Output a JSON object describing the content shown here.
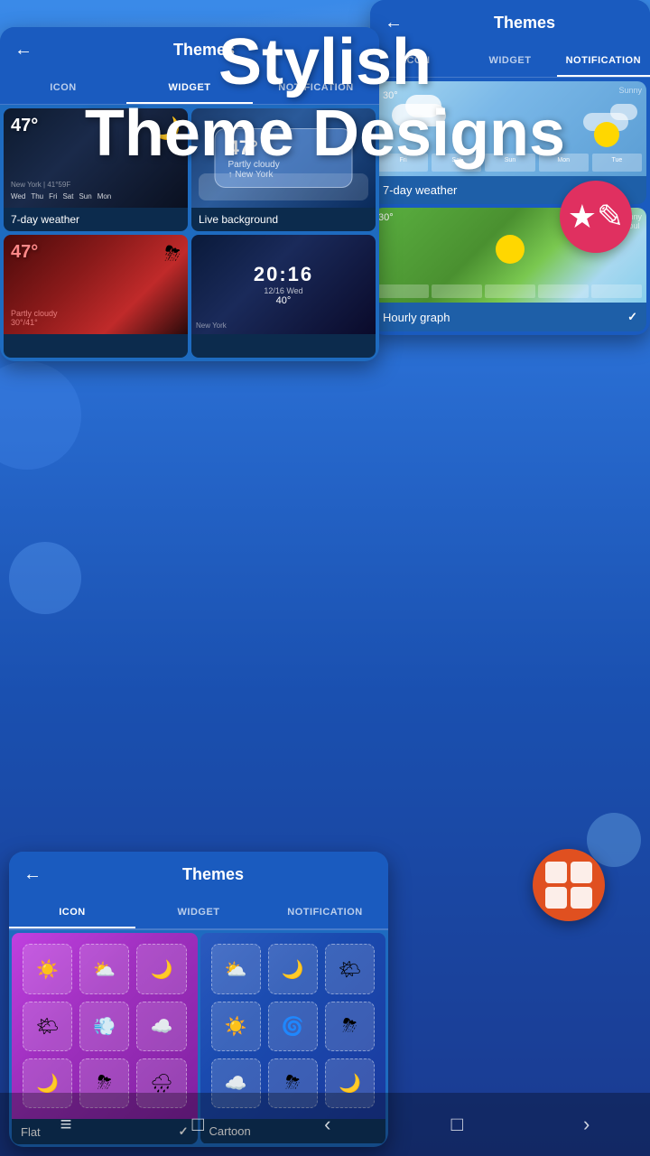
{
  "hero": {
    "title_line1": "Stylish",
    "title_line2": "Theme Designs"
  },
  "badge_button": {
    "icon": "★✎"
  },
  "panel_right": {
    "header_title": "Themes",
    "tabs": [
      "ICON",
      "WIDGET",
      "NOTIFICATION"
    ],
    "active_tab": "NOTIFICATION",
    "cards": [
      {
        "label": "7-day weather",
        "checked": false
      },
      {
        "label": "Hourly graph",
        "checked": true
      }
    ]
  },
  "panel_mid": {
    "header_title": "Themes",
    "tabs": [
      "ICON",
      "WIDGET",
      "NOTIFICATION"
    ],
    "active_tab": "WIDGET",
    "theme_cards": [
      {
        "temp": "47°",
        "label": "7-day weather",
        "type": "dark"
      },
      {
        "temp": "47°",
        "label": "Live background",
        "type": "glass"
      },
      {
        "temp": "47°",
        "label": "",
        "type": "red"
      },
      {
        "temp": "40°",
        "label": "",
        "type": "blue"
      }
    ]
  },
  "panel_bottom": {
    "header_title": "Themes",
    "tabs": [
      "ICON",
      "WIDGET",
      "NOTIFICATION"
    ],
    "active_tab": "ICON",
    "icon_themes": [
      {
        "name": "Flat",
        "checked": true,
        "type": "flat",
        "icons": [
          "☀️",
          "⛅",
          "🌙",
          "🌤",
          "💨",
          "☁️",
          "🌙",
          "⛈",
          "🌧"
        ]
      },
      {
        "name": "Cartoon",
        "checked": false,
        "type": "cartoon",
        "icons": [
          "⛅",
          "🌙",
          "🌤",
          "☀️",
          "🌀",
          "⛈",
          "☁️",
          "⛈",
          "🌙"
        ]
      }
    ]
  },
  "fab": {
    "icon": "grid"
  },
  "nav": {
    "items": [
      "≡",
      "□",
      "‹",
      "□",
      "›"
    ]
  }
}
